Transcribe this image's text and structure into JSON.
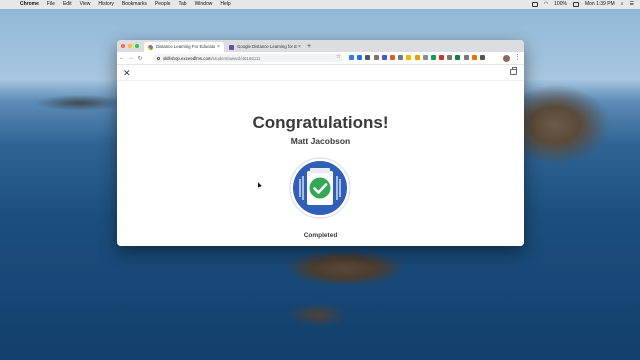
{
  "menubar": {
    "app": "Chrome",
    "items": [
      "File",
      "Edit",
      "View",
      "History",
      "Bookmarks",
      "People",
      "Tab",
      "Window",
      "Help"
    ],
    "battery": "100%",
    "clock": "Mon 1:39 PM"
  },
  "browser": {
    "tabs": [
      {
        "title": "Distance Learning For Educato",
        "active": true,
        "favicon": "google-icon"
      },
      {
        "title": "Google Distance Learning for Ed",
        "active": false,
        "favicon": "skillshop-icon"
      }
    ],
    "new_tab": "+",
    "url_host": "skillshop.exceedlms.com",
    "url_path": "/student/award/46166111",
    "extensions_colors": [
      "#2f7de1",
      "#1a73e8",
      "#555555",
      "#777777",
      "#3b5bdb",
      "#e05a2b",
      "#777777",
      "#f4b400",
      "#f29900",
      "#8a8a8a",
      "#0f9d58",
      "#d93025",
      "#777777",
      "#0b8043",
      "#777777",
      "#e8710a",
      "#555555"
    ]
  },
  "page": {
    "close_symbol": "✕",
    "title": "Congratulations!",
    "recipient": "Matt Jacobson",
    "status": "Completed"
  },
  "colors": {
    "badge_blue": "#2f5fb8",
    "badge_check": "#34a853",
    "heading": "#3a3a3a"
  }
}
